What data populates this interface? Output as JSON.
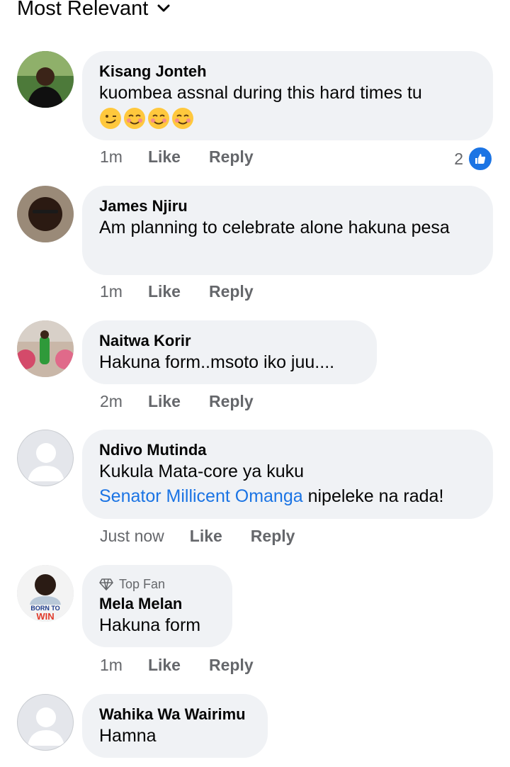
{
  "sort": {
    "label": "Most Relevant",
    "icon": "chevron-down-icon"
  },
  "comments": [
    {
      "name": "Kisang Jonteh",
      "text": "kuombea assnal during this hard times tu",
      "emojis": [
        "smirk",
        "smiling-blush",
        "smiling-blush",
        "smiling-blush"
      ],
      "time": "1m",
      "like": "Like",
      "reply": "Reply",
      "reactions": "2"
    },
    {
      "name": "James Njiru",
      "text": "Am planning to celebrate alone hakuna pesa",
      "time": "1m",
      "like": "Like",
      "reply": "Reply"
    },
    {
      "name": "Naitwa Korir",
      "text": "Hakuna form..msoto iko juu....",
      "time": "2m",
      "like": "Like",
      "reply": "Reply"
    },
    {
      "name": "Ndivo Mutinda",
      "text": "Kukula Mata-core ya kuku",
      "mention": "Senator Millicent Omanga",
      "text_after": " nipeleke na rada!",
      "time": "Just now",
      "like": "Like",
      "reply": "Reply"
    },
    {
      "badge": "Top Fan",
      "name": "Mela Melan",
      "text": "Hakuna form",
      "time": "1m",
      "like": "Like",
      "reply": "Reply",
      "avatar_text": "BORN TO WIN"
    },
    {
      "name": "Wahika Wa Wairimu",
      "text": "Hamna"
    }
  ],
  "colors": {
    "bubble": "#f0f2f5",
    "secondary_text": "#65676b",
    "accent": "#1b74e4"
  }
}
